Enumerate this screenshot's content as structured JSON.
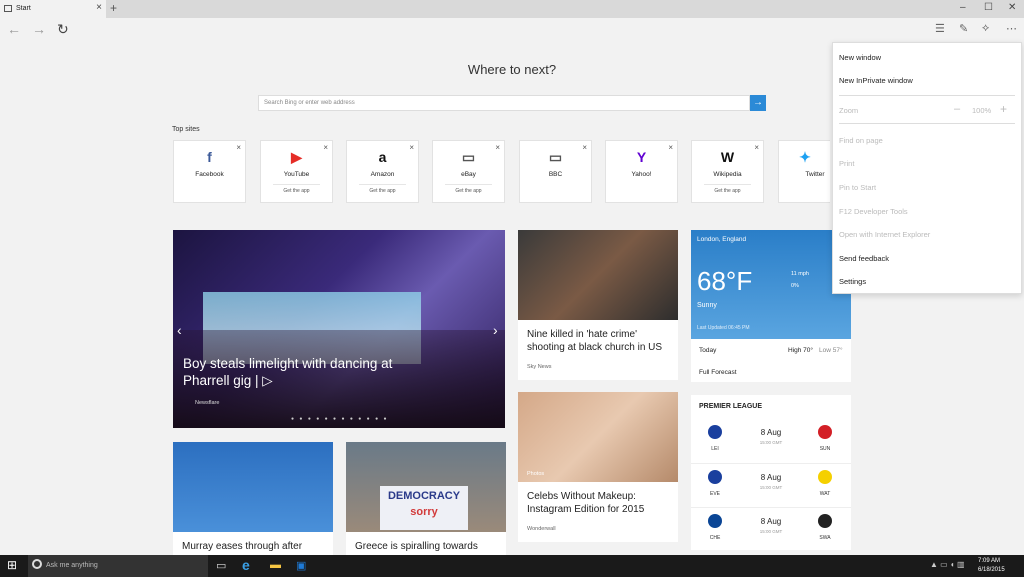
{
  "browser": {
    "tab_title": "Start",
    "new_tab_symbol": "+",
    "window_controls": [
      "–",
      "☐",
      "✕"
    ]
  },
  "page": {
    "heading": "Where to next?",
    "search_placeholder": "Search Bing or enter web address",
    "top_sites_label": "Top sites"
  },
  "top_sites": [
    {
      "name": "Facebook",
      "sub": "",
      "icon_text": "f",
      "color": "#3b5998"
    },
    {
      "name": "YouTube",
      "sub": "Get the app",
      "icon_text": "▶",
      "color": "#e52d27"
    },
    {
      "name": "Amazon",
      "sub": "Get the app",
      "icon_text": "a",
      "color": "#111111"
    },
    {
      "name": "eBay",
      "sub": "Get the app",
      "icon_text": "▭",
      "color": "#555555"
    },
    {
      "name": "BBC",
      "sub": "",
      "icon_text": "▭",
      "color": "#555555"
    },
    {
      "name": "Yahoo!",
      "sub": "",
      "icon_text": "Y",
      "color": "#6001d2"
    },
    {
      "name": "Wikipedia",
      "sub": "Get the app",
      "icon_text": "W",
      "color": "#111111"
    },
    {
      "name": "Twitter",
      "sub": "",
      "icon_text": "✦",
      "color": "#1da1f2"
    }
  ],
  "news": {
    "hero_title": "Boy steals limelight with dancing at Pharrell gig | ▷",
    "hero_source": "Newsflare",
    "card1_title": "Nine killed in 'hate crime' shooting at black church in US",
    "card1_source": "Sky News",
    "card2_title": "Celebs Without Makeup: Instagram Edition for 2015",
    "card2_source": "Wonderwall",
    "card2_photo_label": "Photos",
    "card3_title": "Murray eases through after",
    "card4_title": "Greece is spiralling towards",
    "sign_text_top": "DEMOCRACY",
    "sign_text_bottom": "sorry"
  },
  "weather": {
    "location": "London, England",
    "temp": "68°F",
    "condition": "Sunny",
    "wind": "11 mph",
    "precip": "0%",
    "updated": "Last Updated 06:45 PM",
    "today_label": "Today",
    "high": "High 70°",
    "low": "Low 57°",
    "forecast_label": "Full Forecast"
  },
  "premier_league": {
    "title": "PREMIER LEAGUE",
    "matches": [
      {
        "date": "8 Aug",
        "time": "15:00 GMT",
        "home": "LEI",
        "away": "SUN",
        "home_color": "#1a3f9e",
        "away_color": "#d31f26"
      },
      {
        "date": "8 Aug",
        "time": "15:00 GMT",
        "home": "EVE",
        "away": "WAT",
        "home_color": "#1a3f9e",
        "away_color": "#f5d000"
      },
      {
        "date": "8 Aug",
        "time": "15:00 GMT",
        "home": "CHE",
        "away": "SWA",
        "home_color": "#0a4595",
        "away_color": "#222222"
      }
    ]
  },
  "menu": {
    "new_window": "New window",
    "new_inprivate": "New InPrivate window",
    "zoom_label": "Zoom",
    "zoom_value": "100%",
    "find": "Find on page",
    "print": "Print",
    "pin": "Pin to Start",
    "f12": "F12 Developer Tools",
    "open_ie": "Open with Internet Explorer",
    "feedback": "Send feedback",
    "settings": "Settings"
  },
  "taskbar": {
    "search_placeholder": "Ask me anything",
    "time": "7:09 AM",
    "date": "6/18/2015"
  }
}
